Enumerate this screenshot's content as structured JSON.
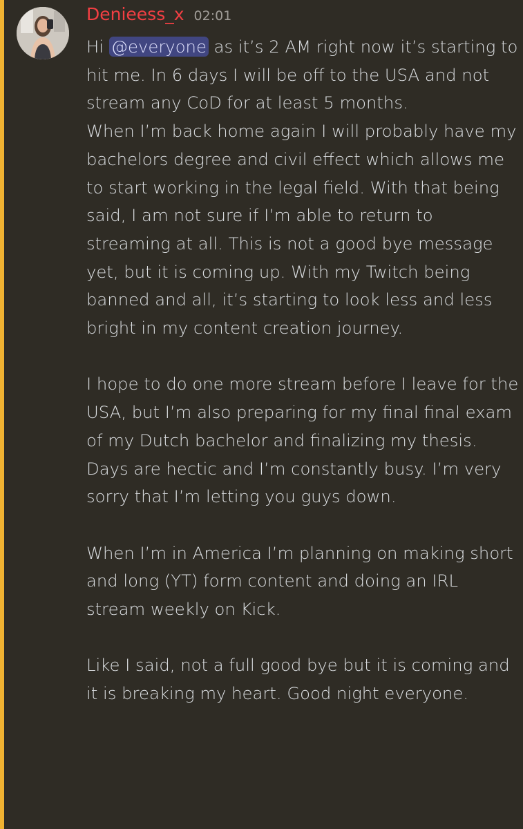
{
  "message": {
    "author": "Denieess_x",
    "timestamp": "02:01",
    "intro": "Hi ",
    "mention": "@everyone",
    "p1_rest": " as it’s 2 AM right now it’s starting to hit me. In 6 days I will be off to the USA and not stream any CoD for at least 5 months.",
    "p2": "When I’m back home again I will probably have my bachelors degree and civil effect which allows me to start working in the legal field. With that being said, I am not sure if I’m able to return to streaming at all. This is not a good bye message yet, but it is coming up. With my Twitch being banned and all, it’s starting to look less and less bright in my content creation journey.",
    "p3": "I hope to do one more stream before I leave for the USA, but I’m also preparing for my final final exam of my Dutch bachelor and finalizing my thesis. Days are hectic and I’m constantly busy. I’m very sorry that I’m letting you guys down.",
    "p4": "When I’m in America I’m planning on making short and long (YT) form content and doing an IRL stream weekly on Kick.",
    "p5": "Like I said, not a full good bye but it is coming and it is breaking my heart. Good night everyone."
  },
  "colors": {
    "background": "#2f2c25",
    "mention_highlight_bar": "#f0b232",
    "username": "#f23f43",
    "text": "#dbdee1",
    "timestamp": "#a09d98",
    "mention_pill": "#5865f2"
  }
}
